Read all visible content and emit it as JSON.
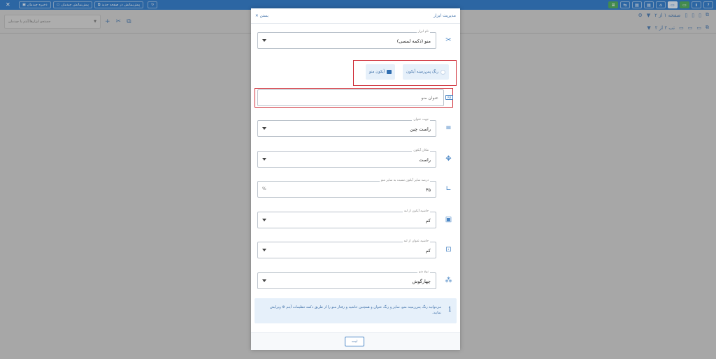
{
  "topbar": {
    "close_glyph": "✕",
    "save_layout": "ذخیره چیدمان",
    "preview_layout": "پیش‌نمایش چیدمان",
    "preview_new_page": "پیش‌نمایش در صفحه جدید",
    "right_icons": [
      "?",
      "ℹ",
      "▭",
      "▭",
      "⌂",
      "▤",
      "▤",
      "⇆",
      "⊞"
    ]
  },
  "background": {
    "search_placeholder": "جستجو ابزارها/آیتم یا چیدمان",
    "page_label": "صفحه ۱ از ۲",
    "page_sub": "تب ۲ از ۲"
  },
  "modal": {
    "title": "مدیریت ابزار",
    "close_label": "بستن",
    "tool_name": {
      "label": "نام ابزار",
      "value": "منو (دکمه لمسی)"
    },
    "chip_bg_color": "رنگ پس‌زمینه آیکون",
    "chip_menu_icon": "آیکون منو",
    "menu_title_placeholder": "عنوان منو",
    "title_icon_text": "AB",
    "title_direction": {
      "label": "جهت عنوان",
      "value": "راست چین"
    },
    "icon_position": {
      "label": "مکان آیکون",
      "value": "راست"
    },
    "icon_size_percent": {
      "label": "درصد سایز آیکون نسبت به سایز منو",
      "value": "۳۵",
      "suffix": "%"
    },
    "icon_margin": {
      "label": "حاشیه آیکون از لبه",
      "value": "کم"
    },
    "title_margin": {
      "label": "حاشیه عنوان از لبه",
      "value": "کم"
    },
    "menu_type": {
      "label": "نوع منو",
      "value": "چهارگوش"
    },
    "info_text": "می‌توانید رنگ پس‌زمینه منو، سایز و رنگ عنوان و همچنین حاشیه و رفتار منو را از طریق دکمه تنظیمات آیتم ⚙ ویرایش نمایید.",
    "submit_label": "ثبت"
  },
  "colors": {
    "accent": "#1f6fc4",
    "highlight": "#d0303a",
    "info_bg": "#e6f0fa"
  }
}
